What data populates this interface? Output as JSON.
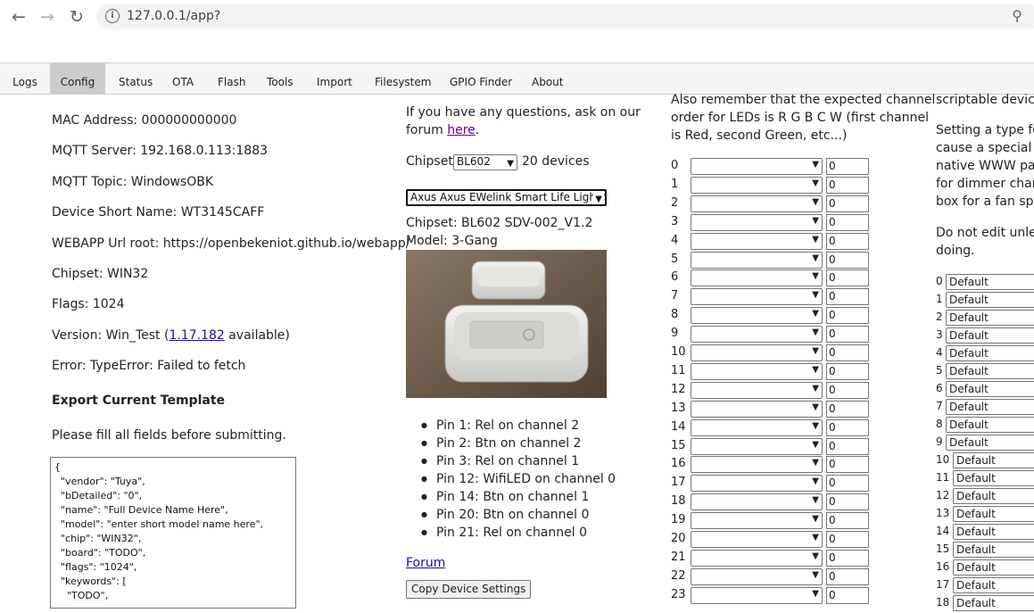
{
  "browser": {
    "url": "127.0.0.1/app?"
  },
  "tabs": [
    "Logs",
    "Config",
    "Status",
    "OTA",
    "Flash",
    "Tools",
    "Import",
    "Filesystem",
    "GPIO Finder",
    "About"
  ],
  "active_tab": "Config",
  "config": {
    "mac": "MAC Address: 000000000000",
    "mqtt_server": "MQTT Server: 192.168.0.113:1883",
    "mqtt_topic": "MQTT Topic: WindowsOBK",
    "short_name": "Device Short Name: WT3145CAFF",
    "webapp_root": "WEBAPP Url root: https://openbekeniot.github.io/webapp/",
    "chipset": "Chipset: WIN32",
    "flags": "Flags: 1024",
    "version_prefix": "Version: Win_Test (",
    "version_link": "1.17.182",
    "version_suffix": " available)",
    "error": "Error: TypeError: Failed to fetch",
    "export_title": "Export Current Template",
    "fill_note": "Please fill all fields before submitting.",
    "template_json": "{\n  \"vendor\": \"Tuya\",\n  \"bDetailed\": \"0\",\n  \"name\": \"Full Device Name Here\",\n  \"model\": \"enter short model name here\",\n  \"chip\": \"WIN32\",\n  \"board\": \"TODO\",\n  \"flags\": \"1024\",\n  \"keywords\": [\n    \"TODO\","
  },
  "devices": {
    "question_line1": "If you have any questions, ask on our",
    "question_line2": "forum ",
    "here_link": "here",
    "question_end": ".",
    "chipset_label": "Chipset:",
    "chipset_value": "BL602",
    "device_count": "20 devices",
    "device_select": "Axus Axus EWelink Smart Life Light Sw",
    "device_chipset": "Chipset: BL602 SDV-002_V1.2",
    "device_model": "Model: 3-Gang",
    "pins": [
      "Pin 1: Rel on channel 2",
      "Pin 2: Btn on channel 2",
      "Pin 3: Rel on channel 1",
      "Pin 12: WifiLED on channel 0",
      "Pin 14: Btn on channel 1",
      "Pin 20: Btn on channel 0",
      "Pin 21: Rel on channel 0"
    ],
    "forum_link": "Forum",
    "copy_button": "Copy Device Settings"
  },
  "channels": {
    "note_line1": "Also remember that the expected channel",
    "note_line2": "order for LEDs is R G B C W (first channel",
    "note_line3": "is Red, second Green, etc...)",
    "value": "0",
    "rows": [
      "0",
      "1",
      "2",
      "3",
      "4",
      "5",
      "6",
      "7",
      "8",
      "9",
      "10",
      "11",
      "12",
      "13",
      "14",
      "15",
      "16",
      "17",
      "18",
      "19",
      "20",
      "21",
      "22",
      "23"
    ]
  },
  "types": {
    "line1": "scriptable devices",
    "line2": "Setting a type for",
    "line3": "cause a special co",
    "line4": "native WWW pag",
    "line5": "for dimmer chann",
    "line6": "box for a fan spee",
    "line7": "Do not edit unles",
    "line8": "doing.",
    "default_label": "Default",
    "rows": [
      "0",
      "1",
      "2",
      "3",
      "4",
      "5",
      "6",
      "7",
      "8",
      "9",
      "10",
      "11",
      "12",
      "13",
      "14",
      "15",
      "16",
      "17",
      "18"
    ]
  }
}
